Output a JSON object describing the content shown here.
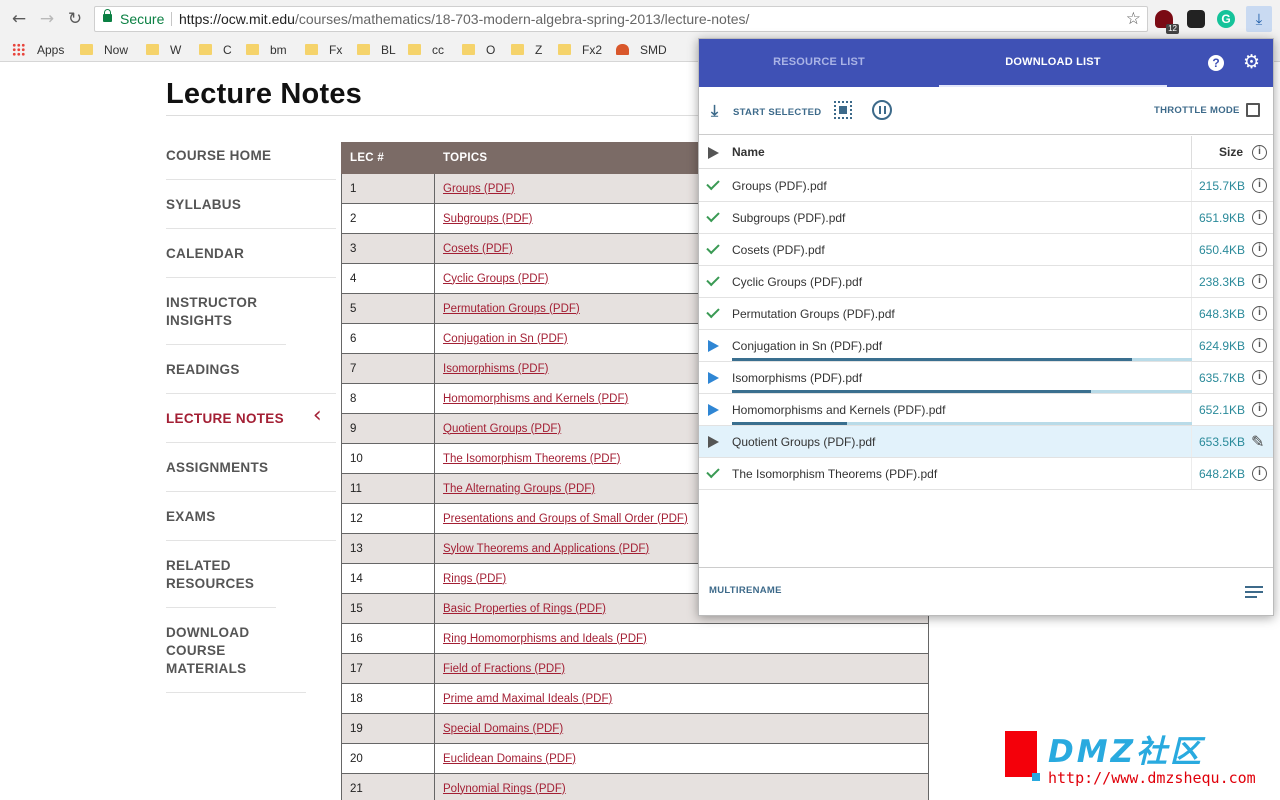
{
  "browser": {
    "secure_label": "Secure",
    "url_host": "https://ocw.mit.edu",
    "url_path": "/courses/mathematics/18-703-modern-algebra-spring-2013/lecture-notes/",
    "ublock_badge": "12",
    "grammarly_letter": "G",
    "bookmarks": [
      "Apps",
      "Now",
      "W",
      "C",
      "bm",
      "Fx",
      "BL",
      "cc",
      "O",
      "Z",
      "Fx2",
      "SMD"
    ]
  },
  "page": {
    "title": "Lecture Notes",
    "sidebar": [
      {
        "label": "COURSE HOME"
      },
      {
        "label": "SYLLABUS"
      },
      {
        "label": "CALENDAR"
      },
      {
        "label": "INSTRUCTOR INSIGHTS"
      },
      {
        "label": "READINGS"
      },
      {
        "label": "LECTURE NOTES",
        "active": true
      },
      {
        "label": "ASSIGNMENTS"
      },
      {
        "label": "EXAMS"
      },
      {
        "label": "RELATED RESOURCES"
      },
      {
        "label": "DOWNLOAD COURSE MATERIALS"
      }
    ],
    "table": {
      "headers": [
        "LEC #",
        "TOPICS"
      ],
      "rows": [
        [
          "1",
          "Groups (PDF)"
        ],
        [
          "2",
          "Subgroups (PDF)"
        ],
        [
          "3",
          "Cosets (PDF)"
        ],
        [
          "4",
          "Cyclic Groups (PDF)"
        ],
        [
          "5",
          "Permutation Groups (PDF)"
        ],
        [
          "6",
          "Conjugation in Sn  (PDF)"
        ],
        [
          "7",
          "Isomorphisms (PDF)"
        ],
        [
          "8",
          "Homomorphisms and Kernels (PDF)"
        ],
        [
          "9",
          "Quotient Groups (PDF)"
        ],
        [
          "10",
          "The Isomorphism Theorems (PDF)"
        ],
        [
          "11",
          "The Alternating Groups (PDF)"
        ],
        [
          "12",
          "Presentations and Groups of Small Order (PDF)"
        ],
        [
          "13",
          "Sylow Theorems and Applications (PDF)"
        ],
        [
          "14",
          "Rings (PDF)"
        ],
        [
          "15",
          "Basic Properties of Rings (PDF)"
        ],
        [
          "16",
          "Ring Homomorphisms and Ideals (PDF)"
        ],
        [
          "17",
          "Field of Fractions (PDF)"
        ],
        [
          "18",
          "Prime amd Maximal Ideals (PDF)"
        ],
        [
          "19",
          "Special Domains (PDF)"
        ],
        [
          "20",
          "Euclidean Domains (PDF)"
        ],
        [
          "21",
          "Polynomial Rings (PDF)"
        ]
      ]
    }
  },
  "downloader": {
    "tabs": [
      "RESOURCE LIST",
      "DOWNLOAD LIST"
    ],
    "help_label": "?",
    "start_selected": "START SELECTED",
    "throttle_mode": "THROTTLE MODE",
    "col_name": "Name",
    "col_size": "Size",
    "info_glyph": "i",
    "multirename": "MULTIRENAME",
    "files": [
      {
        "name": "Groups (PDF).pdf",
        "size": "215.7KB",
        "status": "done"
      },
      {
        "name": "Subgroups (PDF).pdf",
        "size": "651.9KB",
        "status": "done"
      },
      {
        "name": "Cosets (PDF).pdf",
        "size": "650.4KB",
        "status": "done"
      },
      {
        "name": "Cyclic Groups (PDF).pdf",
        "size": "238.3KB",
        "status": "done"
      },
      {
        "name": "Permutation Groups (PDF).pdf",
        "size": "648.3KB",
        "status": "done"
      },
      {
        "name": "Conjugation in Sn (PDF).pdf",
        "size": "624.9KB",
        "status": "downloading",
        "progress": 0.87
      },
      {
        "name": "Isomorphisms (PDF).pdf",
        "size": "635.7KB",
        "status": "downloading",
        "progress": 0.78
      },
      {
        "name": "Homomorphisms and Kernels (PDF).pdf",
        "size": "652.1KB",
        "status": "downloading",
        "progress": 0.25
      },
      {
        "name": "Quotient Groups (PDF).pdf",
        "size": "653.5KB",
        "status": "queued",
        "selected": true
      },
      {
        "name": "The Isomorphism Theorems (PDF).pdf",
        "size": "648.2KB",
        "status": "done"
      }
    ]
  },
  "watermark": {
    "brand": "DMZ社区",
    "url": "http://www.dmzshequ.com"
  },
  "colors": {
    "accent": "#a31f34",
    "popup_header": "#3f51b5",
    "table_header": "#7b6b66",
    "done_check": "#3a9a54",
    "play_blue": "#2f86d4"
  }
}
